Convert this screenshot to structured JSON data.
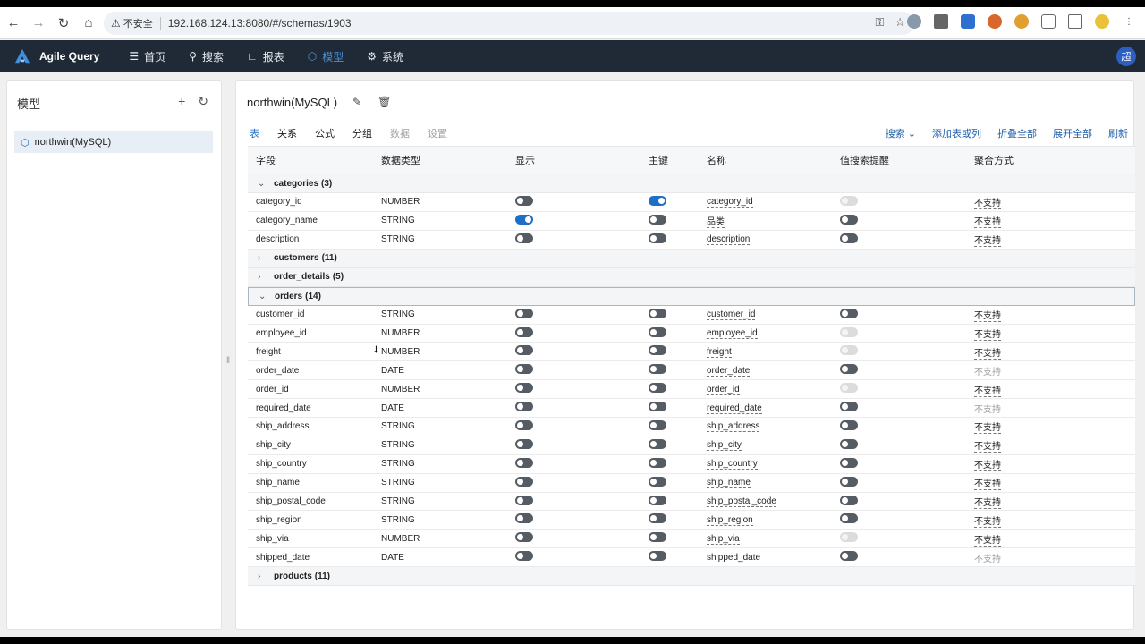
{
  "browser": {
    "url": "192.168.124.13:8080/#/schemas/1903",
    "insecure_label": "不安全"
  },
  "app": {
    "name": "Agile Query",
    "menu": [
      {
        "label": "首页",
        "icon": "layers-icon",
        "active": false
      },
      {
        "label": "搜索",
        "icon": "search-icon",
        "active": false
      },
      {
        "label": "报表",
        "icon": "chart-icon",
        "active": false
      },
      {
        "label": "模型",
        "icon": "cube-icon",
        "active": true
      },
      {
        "label": "系统",
        "icon": "gear-icon",
        "active": false
      }
    ],
    "user_initial": "超"
  },
  "sidebar": {
    "title": "模型",
    "items": [
      {
        "label": "northwin(MySQL)"
      }
    ]
  },
  "main": {
    "title": "northwin(MySQL)",
    "tabs": [
      {
        "label": "表",
        "state": "active"
      },
      {
        "label": "关系",
        "state": "normal"
      },
      {
        "label": "公式",
        "state": "normal"
      },
      {
        "label": "分组",
        "state": "normal"
      },
      {
        "label": "数据",
        "state": "disabled"
      },
      {
        "label": "设置",
        "state": "disabled"
      }
    ],
    "toolbar": {
      "search": "搜索",
      "add": "添加表或列",
      "collapse_all": "折叠全部",
      "expand_all": "展开全部",
      "refresh": "刷新"
    },
    "columns": [
      "字段",
      "数据类型",
      "显示",
      "主键",
      "名称",
      "值搜索提醒",
      "聚合方式"
    ],
    "groups": [
      {
        "name": "categories",
        "count": "(3)",
        "expanded": true,
        "outlined": false,
        "rows": [
          {
            "field": "category_id",
            "type": "NUMBER",
            "show": "off",
            "pk": "on",
            "name": "category_id",
            "hint": "disabled",
            "agg": "不支持",
            "agg_dim": false
          },
          {
            "field": "category_name",
            "type": "STRING",
            "show": "on",
            "pk": "off",
            "name": "品类",
            "hint": "off",
            "agg": "不支持",
            "agg_dim": false
          },
          {
            "field": "description",
            "type": "STRING",
            "show": "off",
            "pk": "off",
            "name": "description",
            "hint": "off",
            "agg": "不支持",
            "agg_dim": false
          }
        ]
      },
      {
        "name": "customers",
        "count": "(11)",
        "expanded": false,
        "outlined": false,
        "rows": []
      },
      {
        "name": "order_details",
        "count": "(5)",
        "expanded": false,
        "outlined": false,
        "rows": []
      },
      {
        "name": "orders",
        "count": "(14)",
        "expanded": true,
        "outlined": true,
        "rows": [
          {
            "field": "customer_id",
            "type": "STRING",
            "show": "off",
            "pk": "off",
            "name": "customer_id",
            "hint": "off",
            "agg": "不支持",
            "agg_dim": false
          },
          {
            "field": "employee_id",
            "type": "NUMBER",
            "show": "off",
            "pk": "off",
            "name": "employee_id",
            "hint": "disabled",
            "agg": "不支持",
            "agg_dim": false
          },
          {
            "field": "freight",
            "type": "NUMBER",
            "show": "off",
            "pk": "off",
            "name": "freight",
            "hint": "disabled",
            "agg": "不支持",
            "agg_dim": false
          },
          {
            "field": "order_date",
            "type": "DATE",
            "show": "off",
            "pk": "off",
            "name": "order_date",
            "hint": "off",
            "agg": "不支持",
            "agg_dim": true
          },
          {
            "field": "order_id",
            "type": "NUMBER",
            "show": "off",
            "pk": "off",
            "name": "order_id",
            "hint": "disabled",
            "agg": "不支持",
            "agg_dim": false
          },
          {
            "field": "required_date",
            "type": "DATE",
            "show": "off",
            "pk": "off",
            "name": "required_date",
            "hint": "off",
            "agg": "不支持",
            "agg_dim": true
          },
          {
            "field": "ship_address",
            "type": "STRING",
            "show": "off",
            "pk": "off",
            "name": "ship_address",
            "hint": "off",
            "agg": "不支持",
            "agg_dim": false
          },
          {
            "field": "ship_city",
            "type": "STRING",
            "show": "off",
            "pk": "off",
            "name": "ship_city",
            "hint": "off",
            "agg": "不支持",
            "agg_dim": false
          },
          {
            "field": "ship_country",
            "type": "STRING",
            "show": "off",
            "pk": "off",
            "name": "ship_country",
            "hint": "off",
            "agg": "不支持",
            "agg_dim": false
          },
          {
            "field": "ship_name",
            "type": "STRING",
            "show": "off",
            "pk": "off",
            "name": "ship_name",
            "hint": "off",
            "agg": "不支持",
            "agg_dim": false
          },
          {
            "field": "ship_postal_code",
            "type": "STRING",
            "show": "off",
            "pk": "off",
            "name": "ship_postal_code",
            "hint": "off",
            "agg": "不支持",
            "agg_dim": false
          },
          {
            "field": "ship_region",
            "type": "STRING",
            "show": "off",
            "pk": "off",
            "name": "ship_region",
            "hint": "off",
            "agg": "不支持",
            "agg_dim": false
          },
          {
            "field": "ship_via",
            "type": "NUMBER",
            "show": "off",
            "pk": "off",
            "name": "ship_via",
            "hint": "disabled",
            "agg": "不支持",
            "agg_dim": false
          },
          {
            "field": "shipped_date",
            "type": "DATE",
            "show": "off",
            "pk": "off",
            "name": "shipped_date",
            "hint": "off",
            "agg": "不支持",
            "agg_dim": true
          }
        ]
      },
      {
        "name": "products",
        "count": "(11)",
        "expanded": false,
        "outlined": false,
        "rows": []
      }
    ]
  }
}
